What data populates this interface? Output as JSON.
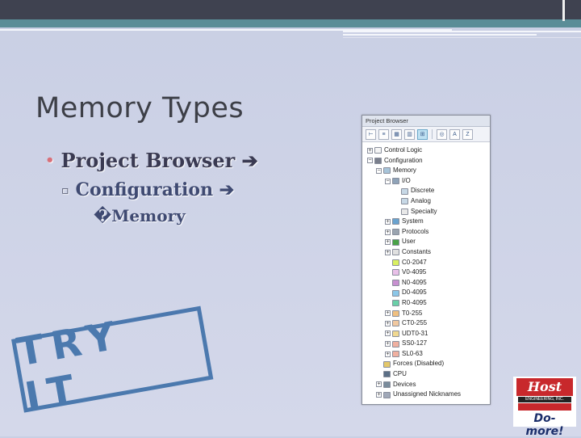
{
  "slide": {
    "title": "Memory Types",
    "bullets": [
      {
        "text": "Project Browser",
        "arrow": "➔"
      },
      {
        "text": "Configuration",
        "arrow": "➔"
      },
      {
        "text": "�Memory"
      }
    ]
  },
  "project_browser": {
    "title": "Project Browser",
    "toolbar_icons": [
      "tree-icon",
      "list-icon",
      "grid-icon",
      "column-icon",
      "expand-icon",
      "filter-icon",
      "a-z-icon",
      "z-a-icon"
    ],
    "tree": [
      {
        "label": "Control Logic",
        "expander": "+",
        "icon": "brace-icon",
        "level": 0
      },
      {
        "label": "Configuration",
        "expander": "−",
        "icon": "gear-icon",
        "level": 0
      },
      {
        "label": "Memory",
        "expander": "−",
        "icon": "memory-icon",
        "level": 1
      },
      {
        "label": "I/O",
        "expander": "−",
        "icon": "io-icon",
        "level": 2
      },
      {
        "label": "Discrete",
        "expander": "",
        "icon": "discrete-icon",
        "level": 3
      },
      {
        "label": "Analog",
        "expander": "",
        "icon": "analog-icon",
        "level": 3
      },
      {
        "label": "Specialty",
        "expander": "",
        "icon": "specialty-icon",
        "level": 3
      },
      {
        "label": "System",
        "expander": "+",
        "icon": "system-icon",
        "level": 2
      },
      {
        "label": "Protocols",
        "expander": "+",
        "icon": "protocols-icon",
        "level": 2
      },
      {
        "label": "User",
        "expander": "+",
        "icon": "user-icon",
        "level": 2
      },
      {
        "label": "Constants",
        "expander": "+",
        "icon": "constants-icon",
        "level": 2
      },
      {
        "label": "C0-2047",
        "expander": "",
        "icon": "bit-icon",
        "level": 2
      },
      {
        "label": "V0-4095",
        "expander": "",
        "icon": "word-icon",
        "level": 2
      },
      {
        "label": "N0-4095",
        "expander": "",
        "icon": "signed-word-icon",
        "level": 2
      },
      {
        "label": "D0-4095",
        "expander": "",
        "icon": "dword-icon",
        "level": 2
      },
      {
        "label": "R0-4095",
        "expander": "",
        "icon": "real-icon",
        "level": 2
      },
      {
        "label": "T0-255",
        "expander": "+",
        "icon": "timer-icon",
        "level": 2
      },
      {
        "label": "CT0-255",
        "expander": "+",
        "icon": "counter-icon",
        "level": 2
      },
      {
        "label": "UDT0-31",
        "expander": "+",
        "icon": "udt-icon",
        "level": 2
      },
      {
        "label": "SS0-127",
        "expander": "+",
        "icon": "string-icon",
        "level": 2
      },
      {
        "label": "SL0-63",
        "expander": "+",
        "icon": "long-string-icon",
        "level": 2
      },
      {
        "label": "Forces (Disabled)",
        "expander": "",
        "icon": "forces-icon",
        "level": 1
      },
      {
        "label": "CPU",
        "expander": "",
        "icon": "cpu-icon",
        "level": 1
      },
      {
        "label": "Devices",
        "expander": "+",
        "icon": "devices-icon",
        "level": 1
      },
      {
        "label": "Unassigned Nicknames",
        "expander": "+",
        "icon": "nickname-icon",
        "level": 1
      }
    ]
  },
  "stamp": {
    "text": "TRY IT"
  },
  "logo": {
    "brand": "Host",
    "subtitle": "ENGINEERING, INC.",
    "product": "Do-more!"
  },
  "colors": {
    "title": "#3d3f47",
    "bullet_dot": "#d8707a",
    "stamp_blue": "#3d6fa8",
    "host_red": "#c8282c"
  }
}
